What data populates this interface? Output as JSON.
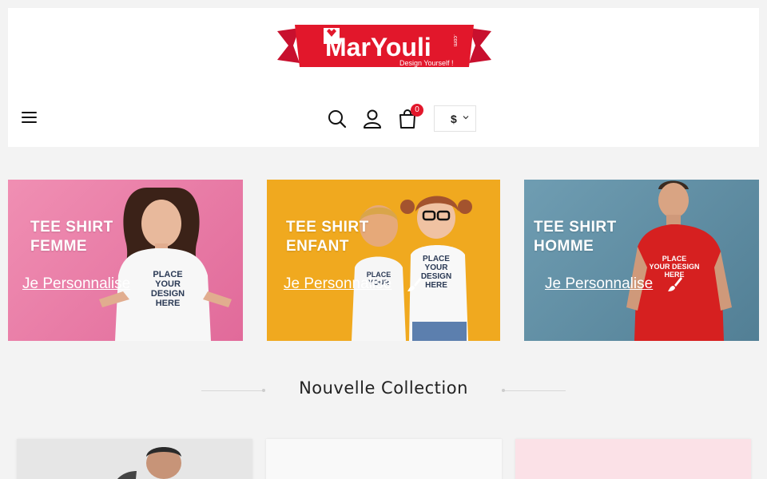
{
  "header": {
    "logo_text": "MarYouli",
    "logo_tagline": "Design Yourself !",
    "logo_com": ".com",
    "cart_count": "0",
    "currency": "$"
  },
  "icons": {
    "menu": "hamburger-icon",
    "search": "search-icon",
    "account": "user-icon",
    "cart": "shopping-bag-icon",
    "currency_toggle": "chevron-down-icon",
    "personalize": "paintbrush-icon"
  },
  "banners": [
    {
      "title_line1": "TEE SHIRT",
      "title_line2": "FEMME",
      "link": "Je Personnalise",
      "shirt_print": "PLACE YOUR DESIGN HERE",
      "bg": "#ec7fa6"
    },
    {
      "title_line1": "TEE SHIRT",
      "title_line2": "ENFANT",
      "link": "Je Personnalise",
      "shirt_print": "PLACE YOUR DESIGN HERE",
      "bg": "#f0a91f"
    },
    {
      "title_line1": "TEE SHIRT",
      "title_line2": "HOMME",
      "link": "Je Personnalise",
      "shirt_print": "PLACE YOUR DESIGN HERE",
      "bg": "#5e8fa5"
    }
  ],
  "section": {
    "title": "Nouvelle Collection"
  },
  "colors": {
    "brand_red": "#e2172b",
    "text_dark": "#222222"
  }
}
